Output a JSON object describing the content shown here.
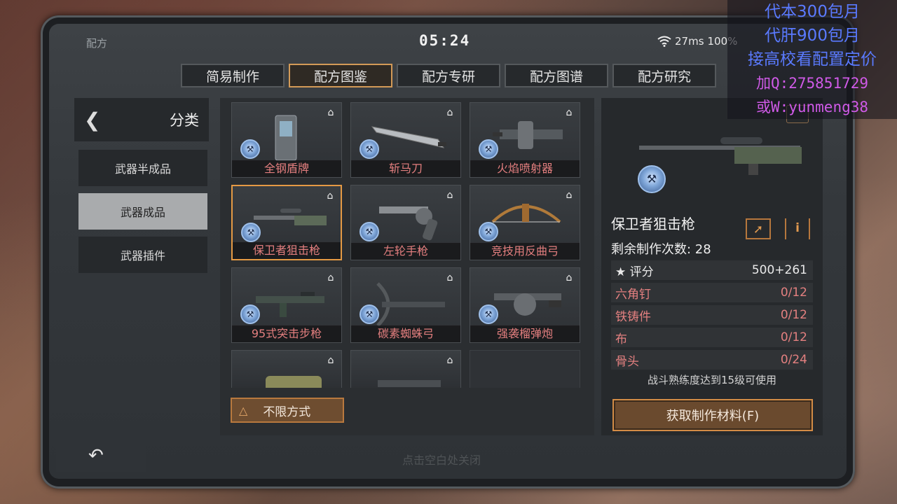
{
  "status": {
    "app": "配方",
    "clock": "05:24",
    "ping": "27ms",
    "battery": "100%"
  },
  "tabs": [
    {
      "label": "简易制作",
      "active": false
    },
    {
      "label": "配方图鉴",
      "active": true
    },
    {
      "label": "配方专研",
      "active": false
    },
    {
      "label": "配方图谱",
      "active": false
    },
    {
      "label": "配方研究",
      "active": false
    }
  ],
  "sidebar": {
    "title": "分类",
    "items": [
      {
        "label": "武器半成品",
        "active": false
      },
      {
        "label": "武器成品",
        "active": true
      },
      {
        "label": "武器插件",
        "active": false
      }
    ]
  },
  "grid": {
    "items": [
      {
        "label": "全钢盾牌",
        "icon": "shield-icon"
      },
      {
        "label": "斩马刀",
        "icon": "blade-icon"
      },
      {
        "label": "火焰喷射器",
        "icon": "flamethrower-icon"
      },
      {
        "label": "保卫者狙击枪",
        "icon": "sniper-rifle-icon",
        "selected": true
      },
      {
        "label": "左轮手枪",
        "icon": "revolver-icon"
      },
      {
        "label": "竞技用反曲弓",
        "icon": "bow-icon"
      },
      {
        "label": "95式突击步枪",
        "icon": "assault-rifle-icon"
      },
      {
        "label": "碳素蜘蛛弓",
        "icon": "crossbow-icon"
      },
      {
        "label": "强袭榴弹炮",
        "icon": "grenade-launcher-icon"
      }
    ]
  },
  "filter": {
    "label": "不限方式"
  },
  "detail": {
    "name": "保卫者狙击枪",
    "count_label": "剩余制作次数: 28",
    "score": {
      "label": "评分",
      "value": "500+261"
    },
    "materials": [
      {
        "name": "六角钉",
        "value": "0/12"
      },
      {
        "name": "铁铸件",
        "value": "0/12"
      },
      {
        "name": "布",
        "value": "0/12"
      },
      {
        "name": "骨头",
        "value": "0/24"
      }
    ],
    "requirement": "战斗熟练度达到15级可使用",
    "obtain_button": "获取制作材料(F)"
  },
  "close_hint": "点击空白处关闭",
  "overlay": {
    "line1": "代本300包月",
    "line2": "代肝900包月",
    "line3": "接高校看配置定价",
    "line4": "加Q:275851729",
    "line5": "或W:yunmeng38"
  },
  "colors": {
    "accent": "#d39a57",
    "label_red": "#e47f7f",
    "panel": "#26292c"
  }
}
